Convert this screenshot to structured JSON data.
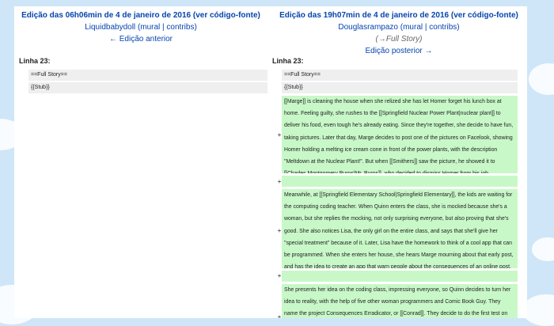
{
  "left_revision": {
    "title": "Edição das 06h06min de 4 de janeiro de 2016 (ver código-fonte)",
    "user": "Liquidbabydoll",
    "user_links": "(mural | contribs)",
    "nav": "← Edição anterior"
  },
  "right_revision": {
    "title": "Edição das 19h07min de 4 de janeiro de 2016 (ver código-fonte)",
    "user": "Douglasrampazo",
    "user_links": "(mural | contribs)",
    "summary": "(→Full Story)",
    "nav": "Edição posterior →"
  },
  "line_label_left": "Linha 23:",
  "line_label_right": "Linha 23:",
  "context_lines": [
    "==Full Story==",
    "{{Stub}}"
  ],
  "added_marker": "+",
  "added_blocks": [
    "[[Marge]] is cleaning the house when she relized she has let Homer forget his lunch box at home. Feeling guilty, she rushes to the [[Springfield Nuclear Power Plant|nuclear plant]] to deliver his food, even tough he's already eating. Since they're together, she decide to have fun, taking pictures. Later that day, Marge decides to post one of the pictures on Facelook, showing Homer holding a melting ice cream cone in front of the power plants, with the description \"Meltdown at the Nuclear Plant!\". But when [[Smithers]] saw the picture, he showed it to [[Charles Montgomery Burns|Mr. Burns]], who decided to dismiss Homer from his job.",
    "",
    "Meanwhile, at [[Springfield Elementary School|Springfield Elementary]], the kids are waiting for the computing coding teacher. When Quinn enters the class, she is mocked because she's a woman, but she replies the mocking, not only surprising everyone, but also proving that she's good. She also notices Lisa, the only girl on the entire class, and says that she'll give her \"special treatment\" because of it. Later, Lisa have the homework to think of a cool app that can be programmed. When she enters her house, she hears Marge mourning about that early post, and has the idea to create an app that warn people about the consequences of an online post.",
    "",
    "She presents her idea on the coding class, impressing everyone, so Quinn decides to turn her idea to reality, with the help of five other woman programmers and Comic Book Guy. They name the project Consequences Erradicator, or [[Conrad]]. They decide to do the first test on"
  ]
}
